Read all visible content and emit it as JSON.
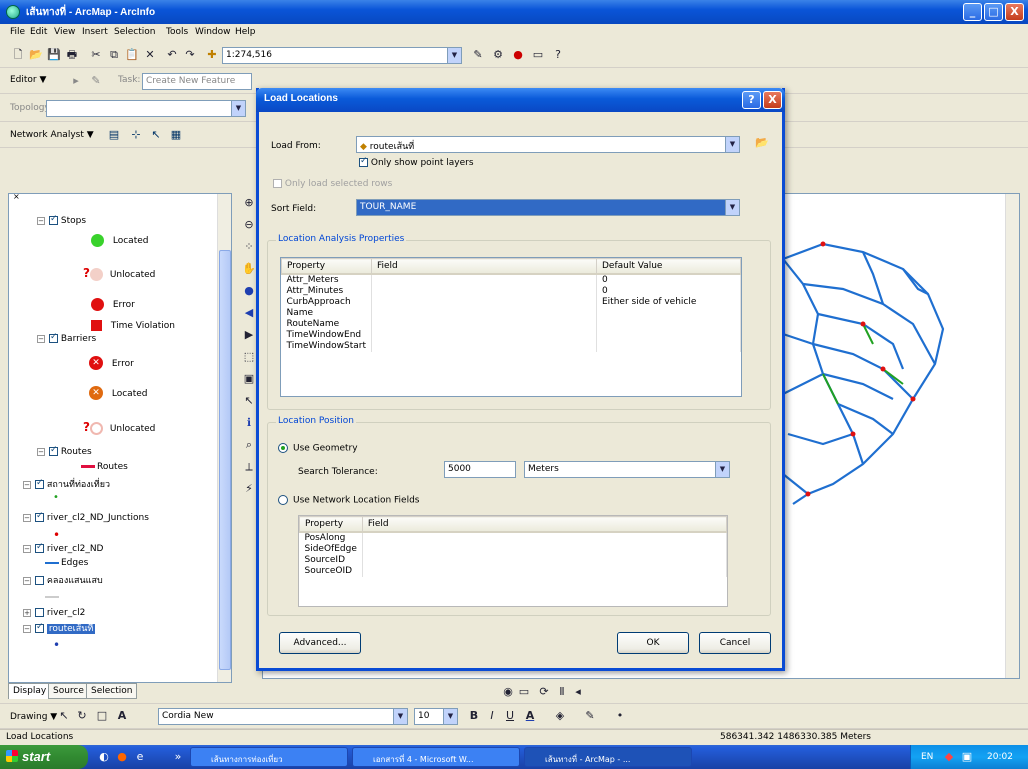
{
  "window": {
    "title": "เส้นทางที่ - ArcMap - ArcInfo",
    "min": "_",
    "max": "□",
    "close": "X"
  },
  "menu": [
    "File",
    "Edit",
    "View",
    "Insert",
    "Selection",
    "Tools",
    "Window",
    "Help"
  ],
  "toolbar1": {
    "scale": "1:274,516"
  },
  "toolbar2": {
    "editor": "Editor ▼",
    "task_label": "Task:",
    "task_value": "Create New Feature"
  },
  "toolbar3": {
    "topology_label": "Topology:"
  },
  "toolbar4": {
    "network_analyst": "Network Analyst ▼"
  },
  "toc": {
    "layers": [
      {
        "label": "Stops"
      },
      {
        "label": "Located"
      },
      {
        "label": "Unlocated"
      },
      {
        "label": "Error"
      },
      {
        "label": "Time Violation"
      },
      {
        "label": "Barriers"
      },
      {
        "label": "Error"
      },
      {
        "label": "Located"
      },
      {
        "label": "Unlocated"
      },
      {
        "label": "Routes"
      },
      {
        "label": "Routes"
      },
      {
        "label": "สถานที่ท่องเที่ยว"
      },
      {
        "label": "river_cl2_ND_Junctions"
      },
      {
        "label": "river_cl2_ND"
      },
      {
        "label": "Edges"
      },
      {
        "label": "คลองแสนแสบ"
      },
      {
        "label": "river_cl2"
      },
      {
        "label": "routeเส้นที่"
      }
    ],
    "tabs": [
      "Display",
      "Source",
      "Selection"
    ]
  },
  "dialog": {
    "title": "Load Locations",
    "help": "?",
    "close": "X",
    "load_from_label": "Load From:",
    "load_from_value": "routeเส้นที่",
    "only_point_layers": "Only show point layers",
    "only_selected_rows": "Only load selected rows",
    "sort_field_label": "Sort Field:",
    "sort_field_value": "TOUR_NAME",
    "analysis_group": "Location Analysis Properties",
    "analysis_headers": [
      "Property",
      "Field",
      "Default Value"
    ],
    "analysis_rows": [
      [
        "Attr_Meters",
        "",
        "0"
      ],
      [
        "Attr_Minutes",
        "",
        "0"
      ],
      [
        "CurbApproach",
        "",
        "Either side of vehicle"
      ],
      [
        "Name",
        "",
        ""
      ],
      [
        "RouteName",
        "",
        ""
      ],
      [
        "TimeWindowEnd",
        "",
        ""
      ],
      [
        "TimeWindowStart",
        "",
        ""
      ]
    ],
    "position_group": "Location Position",
    "use_geometry": "Use Geometry",
    "search_tolerance_label": "Search Tolerance:",
    "search_tolerance_value": "5000",
    "units_value": "Meters",
    "use_network_fields": "Use Network Location Fields",
    "network_headers": [
      "Property",
      "Field"
    ],
    "network_rows": [
      "PosAlong",
      "SideOfEdge",
      "SourceID",
      "SourceOID"
    ],
    "advanced": "Advanced...",
    "ok": "OK",
    "cancel": "Cancel"
  },
  "drawing_toolbar": {
    "drawing": "Drawing ▼",
    "font": "Cordia New",
    "size": "10"
  },
  "status": {
    "left": "Load Locations",
    "coords": "586341.342  1486330.385 Meters"
  },
  "taskbar": {
    "start": "start",
    "tasks": [
      "เส้นทางการท่องเที่ยว",
      "เอกสารที่ 4 - Microsoft W...",
      "เส้นทางที่ - ArcMap - ..."
    ],
    "lang": "EN",
    "clock": "20:02"
  },
  "colors": {
    "title_blue": "#0a55d8",
    "route_blue": "#1f6fd0",
    "accent_green": "#21a121"
  }
}
